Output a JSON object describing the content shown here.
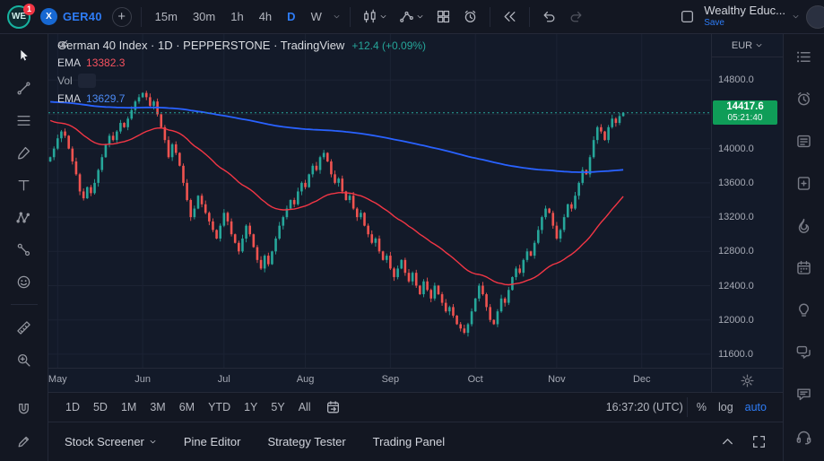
{
  "top_toolbar": {
    "logo_text": "WE",
    "badge": "1",
    "symbol": "GER40",
    "symbol_logo_text": "X",
    "add_symbol": "+",
    "timeframes": [
      "15m",
      "30m",
      "1h",
      "4h",
      "D",
      "W"
    ],
    "active_timeframe": "D",
    "layout_name": "Wealthy Educ...",
    "save_label": "Save"
  },
  "legend": {
    "title": "German 40 Index · 1D · PEPPERSTONE · TradingView",
    "change": "+12.4 (+0.09%)",
    "ema1_label": "EMA",
    "ema1_value": "13382.3",
    "vol_label": "Vol",
    "ema2_label": "EMA",
    "ema2_value": "13629.7"
  },
  "price_scale": {
    "currency": "EUR",
    "labels": [
      "14800.0",
      "14400.0",
      "14000.0",
      "13600.0",
      "13200.0",
      "12800.0",
      "12400.0",
      "12000.0",
      "11600.0"
    ],
    "last_price": "14417.6",
    "countdown": "05:21:40"
  },
  "bottom_toolbar": {
    "ranges": [
      "1D",
      "5D",
      "1M",
      "3M",
      "6M",
      "YTD",
      "1Y",
      "5Y",
      "All"
    ],
    "clock": "16:37:20 (UTC)",
    "percent": "%",
    "log": "log",
    "auto": "auto"
  },
  "panel_tabs": [
    "Stock Screener",
    "Pine Editor",
    "Strategy Tester",
    "Trading Panel"
  ],
  "chart_data": {
    "type": "candlestick",
    "symbol": "German 40 Index",
    "interval": "1D",
    "exchange": "PEPPERSTONE",
    "ylim": [
      11442,
      15337
    ],
    "x_slots": 179,
    "grid_prices": [
      14800,
      14400,
      14000,
      13600,
      13200,
      12800,
      12400,
      12000,
      11600
    ],
    "month_ticks": [
      {
        "label": "May",
        "i": 2
      },
      {
        "label": "Jun",
        "i": 25
      },
      {
        "label": "Jul",
        "i": 47
      },
      {
        "label": "Aug",
        "i": 69
      },
      {
        "label": "Sep",
        "i": 92
      },
      {
        "label": "Oct",
        "i": 115
      },
      {
        "label": "Nov",
        "i": 137
      },
      {
        "label": "Dec",
        "i": 160
      }
    ],
    "open_first": 13850,
    "closes": [
      13900,
      14000,
      14120,
      14200,
      14150,
      14000,
      13850,
      13700,
      13500,
      13420,
      13550,
      13480,
      13600,
      13750,
      13900,
      14050,
      14150,
      14100,
      14200,
      14300,
      14250,
      14350,
      14450,
      14550,
      14600,
      14650,
      14600,
      14500,
      14550,
      14400,
      14250,
      14100,
      13900,
      14050,
      13950,
      13800,
      13600,
      13400,
      13200,
      13300,
      13450,
      13350,
      13250,
      13150,
      13050,
      12950,
      13100,
      13250,
      13150,
      13000,
      12900,
      12800,
      12950,
      13100,
      13000,
      12850,
      12700,
      12600,
      12750,
      12650,
      12800,
      12950,
      13100,
      13200,
      13300,
      13400,
      13350,
      13500,
      13600,
      13550,
      13700,
      13800,
      13750,
      13900,
      13950,
      13850,
      13700,
      13600,
      13650,
      13500,
      13400,
      13450,
      13300,
      13200,
      13250,
      13100,
      13000,
      12900,
      12950,
      12800,
      12700,
      12750,
      12600,
      12500,
      12600,
      12700,
      12550,
      12450,
      12550,
      12400,
      12300,
      12450,
      12350,
      12250,
      12400,
      12300,
      12200,
      12100,
      12150,
      12050,
      11950,
      11900,
      11850,
      11950,
      12100,
      12250,
      12400,
      12300,
      12150,
      12000,
      11950,
      12100,
      12250,
      12200,
      12350,
      12500,
      12600,
      12550,
      12700,
      12800,
      12750,
      12900,
      13050,
      13200,
      13300,
      13250,
      13100,
      12950,
      13050,
      13200,
      13350,
      13300,
      13450,
      13600,
      13750,
      13700,
      13900,
      14100,
      14250,
      14200,
      14100,
      14250,
      14350,
      14300,
      14380,
      14417.6
    ],
    "last_price": 14417.6,
    "overlays": [
      {
        "name": "EMA",
        "period": 40,
        "seed": 14350,
        "color": "#f23645",
        "width": 1.4
      },
      {
        "name": "EMA",
        "period": 350,
        "seed": 14550,
        "color": "#2962ff",
        "width": 1.8
      }
    ],
    "colors": {
      "up": "#26a69a",
      "down": "#ef5350"
    }
  }
}
